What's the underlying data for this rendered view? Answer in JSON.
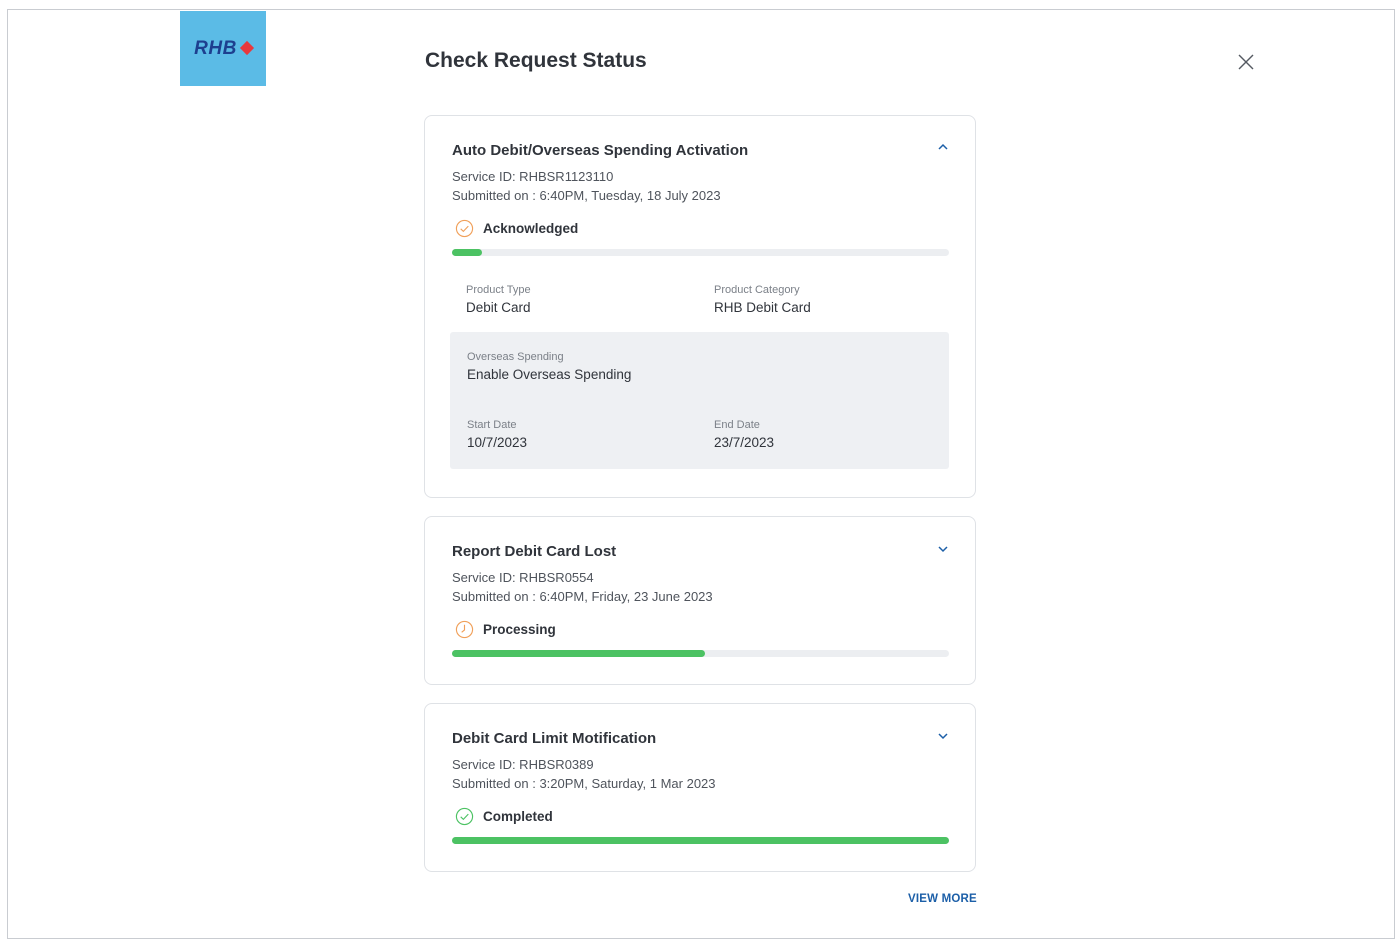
{
  "logo": {
    "text": "RHB"
  },
  "page": {
    "title": "Check Request Status"
  },
  "requests": [
    {
      "title": "Auto Debit/Overseas Spending Activation",
      "service_id": "Service ID: RHBSR1123110",
      "submitted": "Submitted on : 6:40PM, Tuesday, 18 July 2023",
      "status": "Acknowledged",
      "status_icon": "check-circle-icon",
      "status_color": "#f0a05a",
      "progress": 0.06,
      "expanded": true,
      "details": {
        "product_type_label": "Product Type",
        "product_type": "Debit Card",
        "product_category_label": "Product Category",
        "product_category": "RHB Debit Card",
        "overseas_label": "Overseas Spending",
        "overseas_value": "Enable Overseas Spending",
        "start_date_label": "Start Date",
        "start_date": "10/7/2023",
        "end_date_label": "End Date",
        "end_date": "23/7/2023"
      }
    },
    {
      "title": "Report Debit Card Lost",
      "service_id": "Service ID: RHBSR0554",
      "submitted": "Submitted on : 6:40PM, Friday, 23 June 2023",
      "status": "Processing",
      "status_icon": "clock-icon",
      "status_color": "#f0a05a",
      "progress": 0.51,
      "expanded": false
    },
    {
      "title": "Debit Card Limit Motification",
      "service_id": "Service ID: RHBSR0389",
      "submitted": "Submitted on : 3:20PM, Saturday, 1 Mar 2023",
      "status": "Completed",
      "status_icon": "check-circle-icon",
      "status_color": "#4cc263",
      "progress": 1.0,
      "expanded": false
    }
  ],
  "footer": {
    "view_more": "VIEW MORE"
  },
  "colors": {
    "accent": "#1c5fa8",
    "progress": "#4cc263",
    "logo_bg": "#5bbbe6"
  }
}
